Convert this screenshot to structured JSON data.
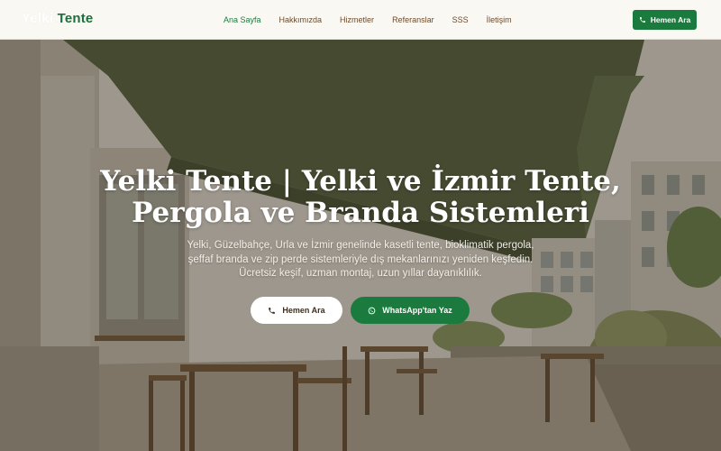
{
  "header": {
    "logo_part1": "Yelki",
    "logo_part2": "Tente",
    "nav": [
      {
        "label": "Ana Sayfa",
        "active": true
      },
      {
        "label": "Hakkımızda",
        "active": false
      },
      {
        "label": "Hizmetler",
        "active": false
      },
      {
        "label": "Referanslar",
        "active": false
      },
      {
        "label": "SSS",
        "active": false
      },
      {
        "label": "İletişim",
        "active": false
      }
    ],
    "cta_label": "Hemen Ara"
  },
  "hero": {
    "title_line1": "Yelki Tente | Yelki ve İzmir Tente,",
    "title_line2": "Pergola ve Branda Sistemleri",
    "subtitle_line1": "Yelki, Güzelbahçe, Urla ve İzmir genelinde kasetli tente, bioklimatik pergola,",
    "subtitle_line2": "şeffaf branda ve zip perde sistemleriyle dış mekanlarınızı yeniden keşfedin.",
    "subtitle_line3": "Ücretsiz keşif, uzman montaj, uzun yıllar dayanıklılık.",
    "btn_call": "Hemen Ara",
    "btn_whatsapp": "WhatsApp'tan Yaz"
  },
  "colors": {
    "brand_green": "#1b7a3d",
    "nav_text": "#6b4b2e",
    "nav_active": "#1d7a3f",
    "header_bg": "#faf8f3"
  },
  "icons": {
    "cta": "phone-icon",
    "whatsapp": "whatsapp-icon"
  }
}
